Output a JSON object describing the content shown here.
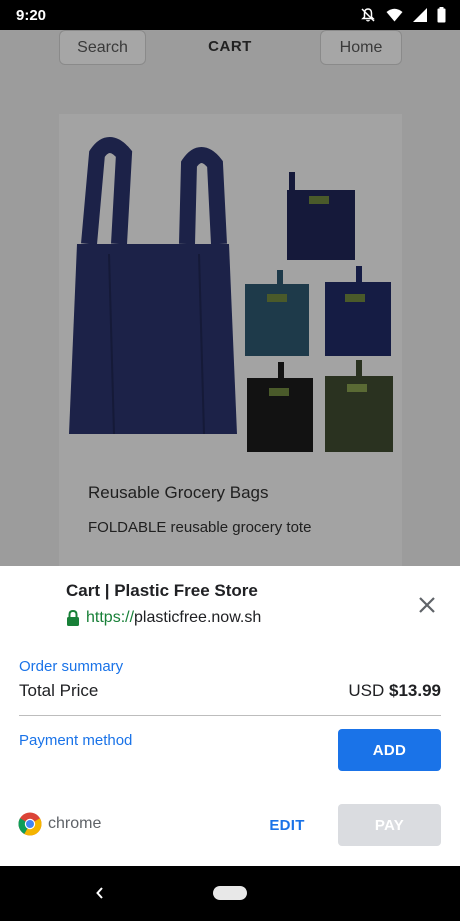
{
  "status_bar": {
    "time": "9:20",
    "icons": [
      "notifications-off-icon",
      "wifi-icon",
      "signal-icon",
      "battery-icon"
    ]
  },
  "page": {
    "header": {
      "search_label": "Search",
      "title": "CART",
      "home_label": "Home"
    },
    "product": {
      "title": "Reusable Grocery Bags",
      "description": "FOLDABLE reusable grocery tote",
      "image": "reusable-grocery-bags-image"
    }
  },
  "payment_sheet": {
    "title": "Cart | Plastic Free Store",
    "url_scheme": "https://",
    "url_host": "plasticfree.now.sh",
    "order_summary_label": "Order summary",
    "total_label": "Total Price",
    "currency": "USD",
    "total_amount": "$13.99",
    "payment_method_label": "Payment method",
    "add_label": "ADD",
    "brand_label": "chrome",
    "edit_label": "EDIT",
    "pay_label": "PAY",
    "colors": {
      "accent": "#1a73e8",
      "secure": "#188038",
      "disabled": "#dadce0"
    }
  },
  "nav_bar": {
    "icons": [
      "back-icon",
      "home-pill-icon"
    ]
  }
}
